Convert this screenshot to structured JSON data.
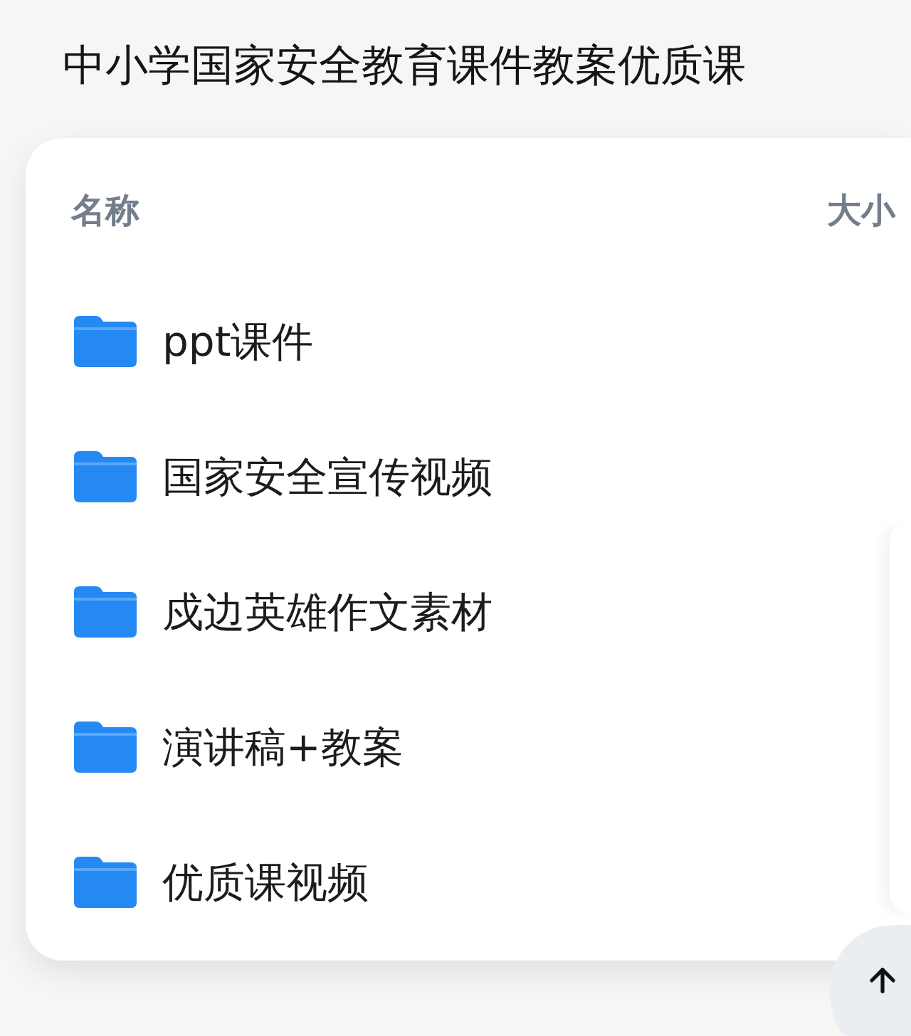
{
  "title": "中小学国家安全教育课件教案优质课",
  "table": {
    "columns": [
      "名称",
      "大小"
    ],
    "rows": [
      {
        "kind": "folder",
        "name": "ppt课件"
      },
      {
        "kind": "folder",
        "name": "国家安全宣传视频"
      },
      {
        "kind": "folder",
        "name": "戍边英雄作文素材"
      },
      {
        "kind": "folder",
        "name": "演讲稿+教案"
      },
      {
        "kind": "folder",
        "name": "优质课视频"
      }
    ]
  }
}
